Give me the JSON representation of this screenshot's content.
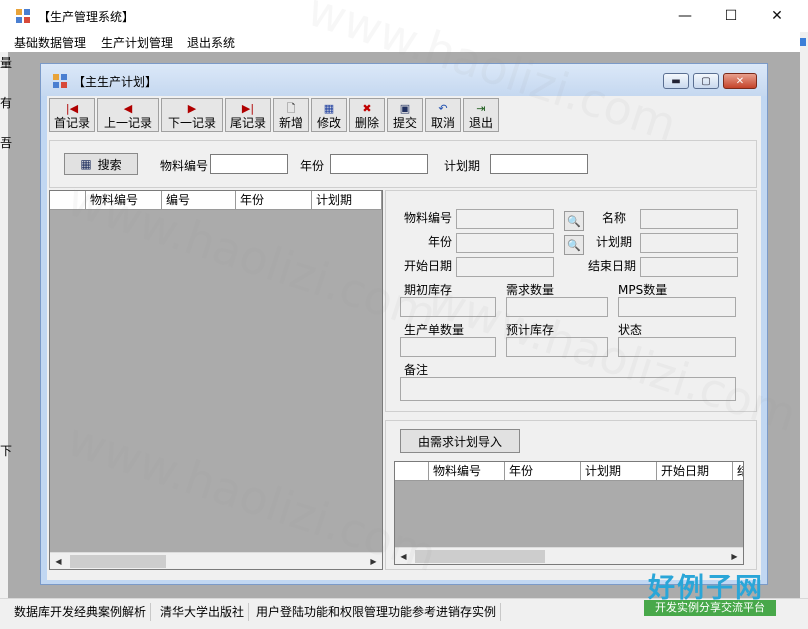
{
  "app": {
    "title": "【生产管理系统】"
  },
  "window_controls": {
    "minimize": "—",
    "maximize": "☐",
    "close": "✕"
  },
  "menu": [
    "基础数据管理",
    "生产计划管理",
    "退出系统"
  ],
  "left_edge_chars": [
    "量",
    "有",
    "吾",
    "下"
  ],
  "child": {
    "title": "【主生产计划】"
  },
  "toolbar": [
    {
      "label": "首记录",
      "glyph": "|◀",
      "color": "#b00000"
    },
    {
      "label": "上一记录",
      "glyph": "◀",
      "color": "#b00000"
    },
    {
      "label": "下一记录",
      "glyph": "▶",
      "color": "#b00000"
    },
    {
      "label": "尾记录",
      "glyph": "▶|",
      "color": "#b00000"
    },
    {
      "label": "新增",
      "glyph": "🗋",
      "color": "#333333"
    },
    {
      "label": "修改",
      "glyph": "▦",
      "color": "#2040a0"
    },
    {
      "label": "删除",
      "glyph": "✖",
      "color": "#c00000"
    },
    {
      "label": "提交",
      "glyph": "▣",
      "color": "#203060"
    },
    {
      "label": "取消",
      "glyph": "↶",
      "color": "#2050b0"
    },
    {
      "label": "退出",
      "glyph": "⇥",
      "color": "#206020"
    }
  ],
  "search": {
    "button": "搜索",
    "material_label": "物料编号",
    "year_label": "年份",
    "plan_label": "计划期"
  },
  "left_grid": {
    "columns": [
      "物料编号",
      "编号",
      "年份",
      "计划期"
    ]
  },
  "detail": {
    "material_no": "物料编号",
    "name": "名称",
    "year": "年份",
    "plan_period": "计划期",
    "start_date": "开始日期",
    "end_date": "结束日期",
    "opening_stock": "期初库存",
    "demand_qty": "需求数量",
    "mps_qty": "MPS数量",
    "production_qty": "生产单数量",
    "projected_stock": "预计库存",
    "status": "状态",
    "remark": "备注"
  },
  "import": {
    "button": "由需求计划导入"
  },
  "right_grid": {
    "columns": [
      "物料编号",
      "年份",
      "计划期",
      "开始日期",
      "结"
    ]
  },
  "statusbar": [
    "数据库开发经典案例解析",
    "清华大学出版社",
    "用户登陆功能和权限管理功能参考进销存实例"
  ],
  "watermark": "www.haolizi.com",
  "brand": {
    "name": "好例子网",
    "tagline": "开发实例分享交流平台",
    "color": "#2aa6d8",
    "tag_bg": "#48a84a"
  }
}
